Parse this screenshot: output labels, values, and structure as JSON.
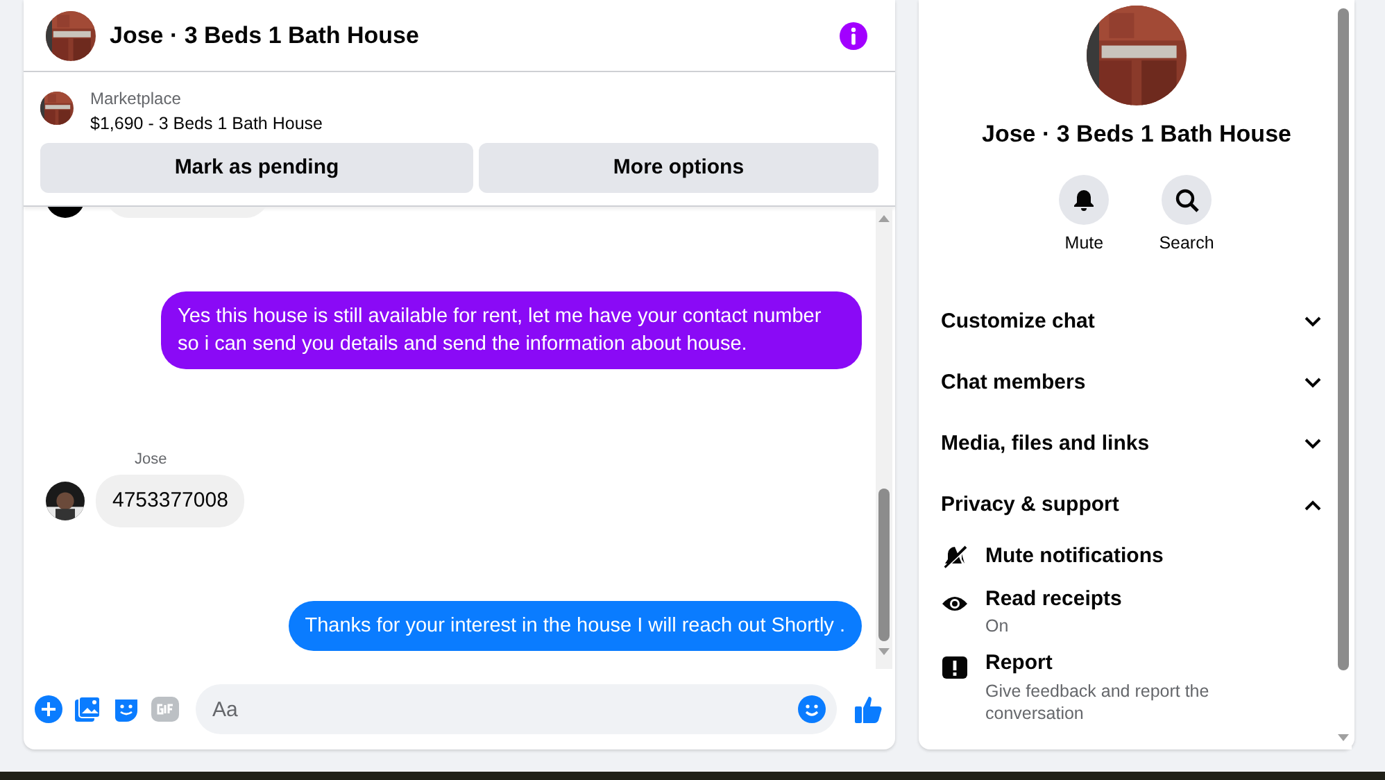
{
  "conversation": {
    "title": "Jose · 3 Beds 1 Bath House"
  },
  "listing": {
    "source": "Marketplace",
    "summary": "$1,690 - 3 Beds 1 Bath House",
    "buttons": [
      "Mark as pending",
      "More options"
    ]
  },
  "messages": [
    {
      "kind": "clipped"
    },
    {
      "kind": "outgoing",
      "text": "Yes this house is still available for rent, let me have your contact number so i can send you details and send the information about house.",
      "color": "#8a0af6"
    },
    {
      "kind": "incoming",
      "sender": "Jose",
      "text": "4753377008"
    },
    {
      "kind": "outgoing",
      "text": "Thanks for your interest in the house I will reach out Shortly .",
      "color": "#0a7cff"
    }
  ],
  "composer": {
    "placeholder": "Aa"
  },
  "details": {
    "title": "Jose · 3 Beds 1 Bath House",
    "actions": [
      {
        "kind": "mute",
        "label": "Mute"
      },
      {
        "kind": "search",
        "label": "Search"
      }
    ],
    "sections": [
      {
        "label": "Customize chat",
        "expanded": false
      },
      {
        "label": "Chat members",
        "expanded": false
      },
      {
        "label": "Media, files and links",
        "expanded": false
      },
      {
        "label": "Privacy & support",
        "expanded": true,
        "items": [
          {
            "kind": "mute",
            "label": "Mute notifications"
          },
          {
            "kind": "receipts",
            "label": "Read receipts",
            "sub": "On"
          },
          {
            "kind": "report",
            "label": "Report",
            "sub": "Give feedback and report the conversation"
          }
        ]
      }
    ]
  }
}
